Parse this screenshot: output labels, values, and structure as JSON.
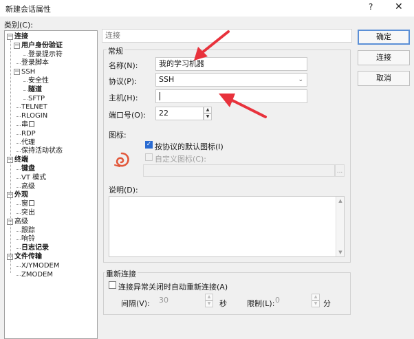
{
  "window": {
    "title": "新建会话属性",
    "help": "?",
    "close": "✕"
  },
  "category_label": "类别(C):",
  "tree": [
    {
      "label": "连接",
      "bold": true,
      "level": 0,
      "expander": "−"
    },
    {
      "label": "用户身份验证",
      "bold": true,
      "level": 1,
      "expander": "−"
    },
    {
      "label": "登录提示符",
      "bold": false,
      "level": 2
    },
    {
      "label": "登录脚本",
      "bold": false,
      "level": 1
    },
    {
      "label": "SSH",
      "bold": false,
      "level": 1,
      "expander": "−"
    },
    {
      "label": "安全性",
      "bold": false,
      "level": 2
    },
    {
      "label": "隧道",
      "bold": true,
      "level": 2
    },
    {
      "label": "SFTP",
      "bold": false,
      "level": 2
    },
    {
      "label": "TELNET",
      "bold": false,
      "level": 1
    },
    {
      "label": "RLOGIN",
      "bold": false,
      "level": 1
    },
    {
      "label": "串口",
      "bold": false,
      "level": 1
    },
    {
      "label": "RDP",
      "bold": false,
      "level": 1
    },
    {
      "label": "代理",
      "bold": false,
      "level": 1
    },
    {
      "label": "保持活动状态",
      "bold": false,
      "level": 1
    },
    {
      "label": "终端",
      "bold": true,
      "level": 0,
      "expander": "−"
    },
    {
      "label": "键盘",
      "bold": true,
      "level": 1
    },
    {
      "label": "VT 模式",
      "bold": false,
      "level": 1
    },
    {
      "label": "高级",
      "bold": false,
      "level": 1
    },
    {
      "label": "外观",
      "bold": true,
      "level": 0,
      "expander": "−"
    },
    {
      "label": "窗口",
      "bold": false,
      "level": 1
    },
    {
      "label": "突出",
      "bold": false,
      "level": 1
    },
    {
      "label": "高级",
      "bold": false,
      "level": 0,
      "expander": "−"
    },
    {
      "label": "跟踪",
      "bold": false,
      "level": 1
    },
    {
      "label": "响铃",
      "bold": false,
      "level": 1
    },
    {
      "label": "日志记录",
      "bold": true,
      "level": 1
    },
    {
      "label": "文件传输",
      "bold": true,
      "level": 0,
      "expander": "−"
    },
    {
      "label": "X/YMODEM",
      "bold": false,
      "level": 1
    },
    {
      "label": "ZMODEM",
      "bold": false,
      "level": 1
    }
  ],
  "section_header": "连接",
  "general": {
    "group_title": "常规",
    "name_label": "名称(N):",
    "name_value": "我的学习机器",
    "protocol_label": "协议(P):",
    "protocol_value": "SSH",
    "host_label": "主机(H):",
    "host_value": "",
    "port_label": "端口号(O):",
    "port_value": "22",
    "icon_label": "图标:",
    "default_icon_label": "按协议的默认图标(I)",
    "custom_icon_label": "自定义图标(C):",
    "browse_label": "...",
    "desc_label": "说明(D):"
  },
  "reconnect": {
    "group_title": "重新连接",
    "checkbox_label": "连接异常关闭时自动重新连接(A)",
    "interval_label": "间隔(V):",
    "interval_value": "30",
    "interval_unit": "秒",
    "limit_label": "限制(L):",
    "limit_value": "0",
    "limit_unit": "分"
  },
  "buttons": {
    "ok": "确定",
    "connect": "连接",
    "cancel": "取消"
  },
  "colors": {
    "accent": "#2a6bd1",
    "arrow": "#e8323c"
  },
  "icons": [
    "help-icon",
    "close-icon",
    "chevron-down-icon",
    "spin-up-icon",
    "spin-down-icon",
    "session-icon",
    "check-icon"
  ]
}
